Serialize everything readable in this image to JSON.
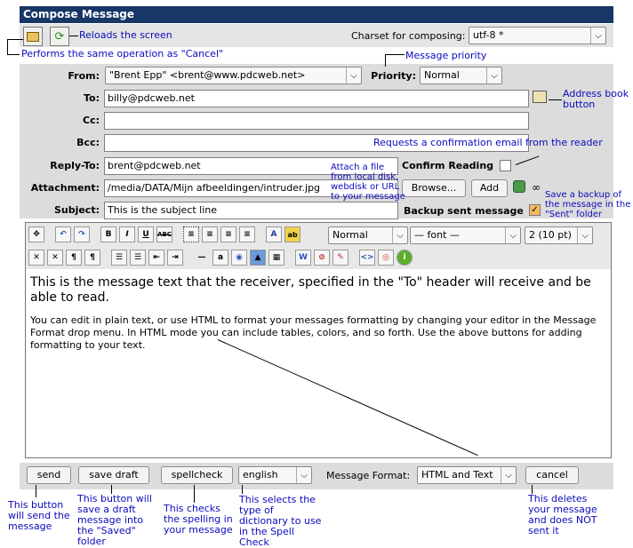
{
  "title": "Compose Message",
  "charset": {
    "label": "Charset for composing:",
    "value": "utf-8 *"
  },
  "notes": {
    "reload": "Reloads the screen",
    "cancel_same": "Performs the same operation as \"Cancel\"",
    "priority": "Message priority",
    "addressbook": "Address book button",
    "confirm": "Requests a confirmation email from the reader",
    "attach": "Attach a file from local disk, webdisk or URL to your message",
    "backup": "Save a backup of the message in the \"Sent\" folder",
    "send": "This button will send the message",
    "save_draft": "This button will save a draft message into the \"Saved\" folder",
    "spellcheck": "This checks the spelling in your message",
    "dictionary": "This selects the type of dictionary to use in the Spell Check",
    "cancel": "This deletes your message and does NOT sent it"
  },
  "fields": {
    "from_label": "From:",
    "from_value": "\"Brent Epp\" <brent@www.pdcweb.net>",
    "priority_label": "Priority:",
    "priority_value": "Normal",
    "to_label": "To:",
    "to_value": "billy@pdcweb.net",
    "cc_label": "Cc:",
    "bcc_label": "Bcc:",
    "replyto_label": "Reply-To:",
    "replyto_value": "brent@pdcweb.net",
    "confirm_label": "Confirm Reading",
    "attachment_label": "Attachment:",
    "attachment_value": "/media/DATA/Mijn afbeeldingen/intruder.jpg",
    "browse": "Browse...",
    "add": "Add",
    "subject_label": "Subject:",
    "subject_value": "This is the subject line",
    "backup_label": "Backup sent message"
  },
  "toolbar": {
    "style": "Normal",
    "font": "— font —",
    "size": "2 (10 pt)"
  },
  "body": {
    "p1": "This is the message text that the receiver, specified in the \"To\" header will  receive and be able to read.",
    "p2": "You can edit in plain text, or use HTML to format your messages formatting by changing your editor in the Message Format drop menu. In HTML mode you can include tables, colors, and so forth. Use the above buttons for adding formatting to your text."
  },
  "bottom": {
    "send": "send",
    "save_draft": "save draft",
    "spellcheck": "spellcheck",
    "dictionary": "english",
    "format_label": "Message Format:",
    "format_value": "HTML and Text",
    "cancel": "cancel"
  },
  "colors": {
    "titlebar": "#173766",
    "note": "#0b0bbd"
  }
}
